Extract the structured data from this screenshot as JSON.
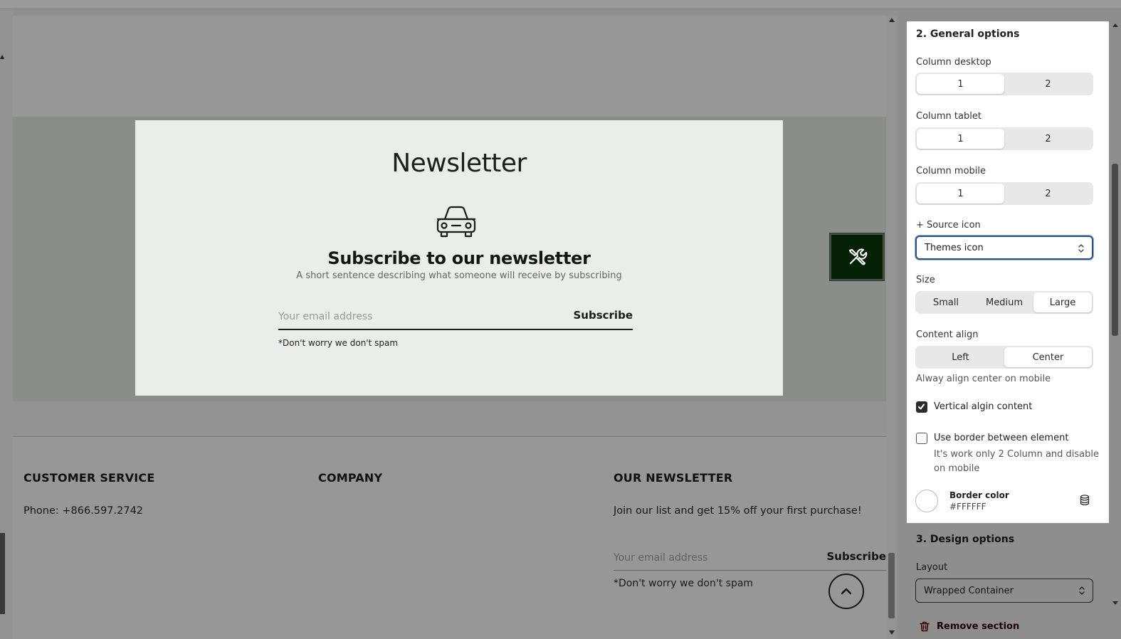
{
  "preview": {
    "newsletter": {
      "title": "Newsletter",
      "icon": "car-icon",
      "heading": "Subscribe to our newsletter",
      "description": "A short sentence describing what someone will receive by subscribing",
      "email_placeholder": "Your email address",
      "subscribe_label": "Subscribe",
      "note": "*Don't worry we don't spam"
    },
    "tool_button": {
      "icon": "tools-icon"
    },
    "footer": {
      "customer_service": {
        "heading": "CUSTOMER SERVICE",
        "phone": "Phone: +866.597.2742"
      },
      "company": {
        "heading": "COMPANY"
      },
      "our_newsletter": {
        "heading": "OUR NEWSLETTER",
        "text": "Join our list and get 15% off your first purchase!",
        "email_placeholder": "Your email address",
        "subscribe_label": "Subscribe",
        "note": "*Don't worry we don't spam"
      },
      "back_to_top_icon": "chevron-up-icon"
    }
  },
  "panel": {
    "general": {
      "title": "2. General options",
      "column_desktop": {
        "label": "Column desktop",
        "options": [
          "1",
          "2"
        ],
        "selected": "1"
      },
      "column_tablet": {
        "label": "Column tablet",
        "options": [
          "1",
          "2"
        ],
        "selected": "1"
      },
      "column_mobile": {
        "label": "Column mobile",
        "options": [
          "1",
          "2"
        ],
        "selected": "1"
      },
      "source_icon": {
        "label": "+ Source icon",
        "value": "Themes icon"
      },
      "size": {
        "label": "Size",
        "options": [
          "Small",
          "Medium",
          "Large"
        ],
        "selected": "Large"
      },
      "content_align": {
        "label": "Content align",
        "options": [
          "Left",
          "Center"
        ],
        "selected": "Center",
        "help": "Alway align center on mobile"
      },
      "vertical_align": {
        "label": "Vertical algin content",
        "checked": true
      },
      "use_border": {
        "label": "Use border between element",
        "checked": false,
        "help": "It's work only 2 Column and disable on mobile"
      },
      "border_color": {
        "label": "Border color",
        "value": "#FFFFFF",
        "icon": "database-icon"
      }
    },
    "design": {
      "title": "3. Design options",
      "layout": {
        "label": "Layout",
        "value": "Wrapped Container"
      }
    },
    "remove": {
      "label": "Remove section",
      "icon": "trash-icon"
    }
  },
  "colors": {
    "tool_button_bg": "#052105",
    "newsletter_card_bg": "#e9eeea",
    "focus_border": "#2c4f8a"
  }
}
